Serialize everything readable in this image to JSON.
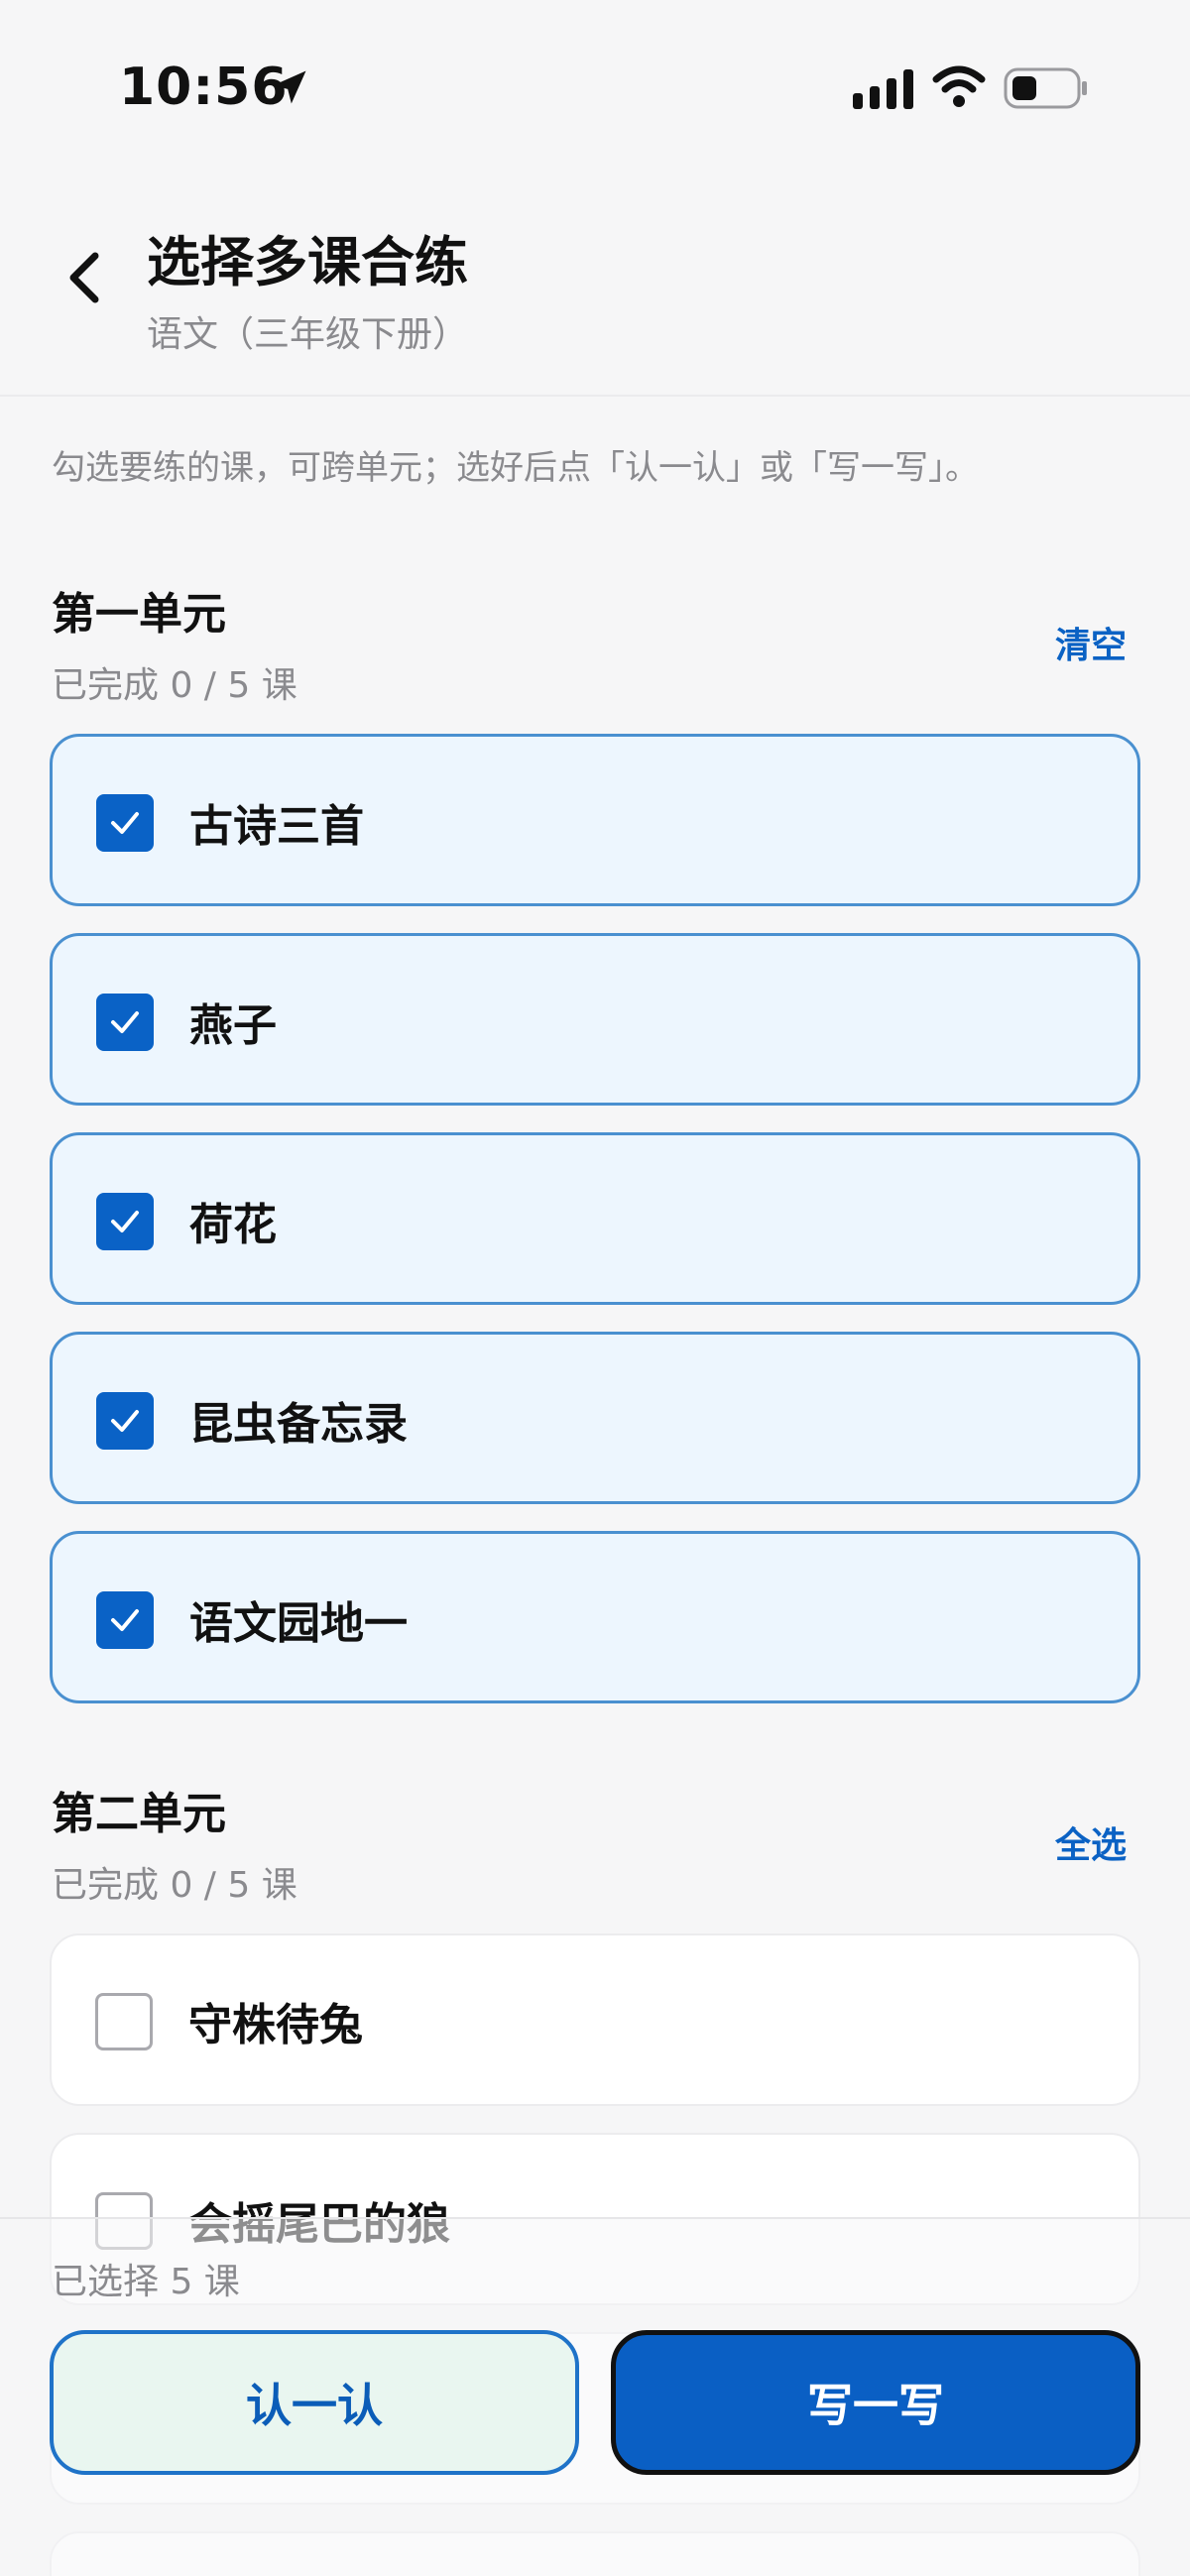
{
  "status_bar": {
    "time": "10:56"
  },
  "header": {
    "title": "选择多课合练",
    "subtitle": "语文（三年级下册）"
  },
  "hint": "勾选要练的课，可跨单元；选好后点「认一认」或「写一写」。",
  "units": [
    {
      "title": "第一单元",
      "progress": "已完成 0 / 5 课",
      "action": "清空",
      "lessons": [
        {
          "label": "古诗三首",
          "checked": true
        },
        {
          "label": "燕子",
          "checked": true
        },
        {
          "label": "荷花",
          "checked": true
        },
        {
          "label": "昆虫备忘录",
          "checked": true
        },
        {
          "label": "语文园地一",
          "checked": true
        }
      ]
    },
    {
      "title": "第二单元",
      "progress": "已完成 0 / 5 课",
      "action": "全选",
      "lessons": [
        {
          "label": "守株待兔",
          "checked": false
        },
        {
          "label": "会摇尾巴的狼",
          "checked": false
        }
      ]
    }
  ],
  "bottom_bar": {
    "selected_count": "已选择 5 课",
    "recognize_label": "认一认",
    "write_label": "写一写"
  },
  "colors": {
    "accent": "#0a62c6",
    "checked_card_bg": "#edf6fe",
    "checked_card_border": "#4a90d0",
    "secondary_text": "#8a8a8e"
  },
  "icons": [
    "location-arrow-icon",
    "cellular-signal-icon",
    "wifi-icon",
    "battery-icon",
    "back-chevron-icon",
    "checkmark-icon"
  ]
}
